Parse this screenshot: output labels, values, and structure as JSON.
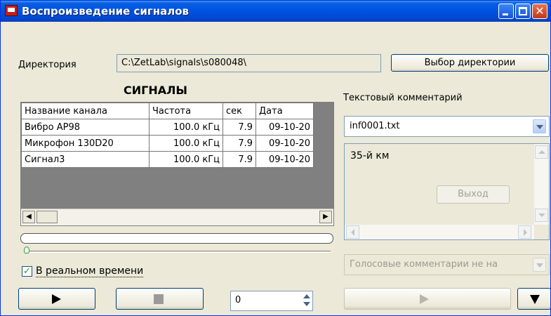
{
  "window": {
    "title": "Воспроизведение сигналов"
  },
  "directory": {
    "label": "Директория",
    "path": "C:\\ZetLab\\signals\\s080048\\",
    "button_label": "Выбор директории"
  },
  "signals": {
    "heading": "СИГНАЛЫ",
    "columns": [
      "Название канала",
      "Частота",
      "сек",
      "Дата"
    ],
    "rows": [
      [
        "Вибро АР98",
        "100.0 кГц",
        "7.9",
        "09-10-20"
      ],
      [
        "Микрофон 130D20",
        "100.0 кГц",
        "7.9",
        "09-10-20"
      ],
      [
        "Сигнал3",
        "100.0 кГц",
        "7.9",
        "09-10-20"
      ]
    ]
  },
  "realtime": {
    "label": "В реальном времени",
    "checked": true
  },
  "playback": {
    "position_value": "0"
  },
  "comment": {
    "heading": "Текстовый комментарий",
    "file": "inf0001.txt",
    "text": "35-й км",
    "exit_label": "Выход"
  },
  "voice": {
    "combo_text": "Голосовые комментарии не на"
  },
  "colors": {
    "titlebar": "#0055e5",
    "window_bg": "#ece9d8",
    "table_bg": "#808080",
    "check_mark": "#21a121"
  },
  "icons": {
    "app": "app-icon",
    "minimize": "minimize-icon",
    "maximize": "maximize-icon",
    "close": "close-icon",
    "play": "play-icon",
    "stop": "stop-icon",
    "down": "triangle-down-icon"
  }
}
